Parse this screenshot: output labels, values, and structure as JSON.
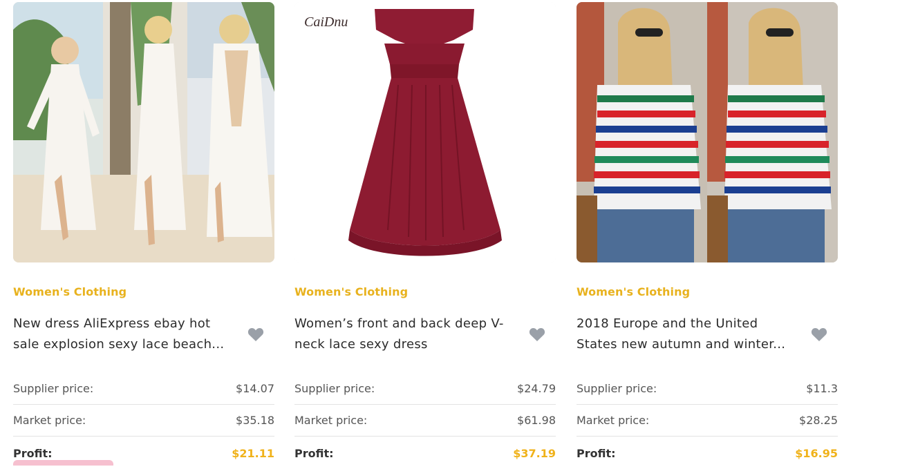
{
  "products": [
    {
      "image_desc": "white-lace-beach-dress-photo",
      "category": "Women's Clothing",
      "title": "New dress AliExpress ebay hot sale explosion sexy lace beach...",
      "supplier_label": "Supplier price:",
      "supplier_price": "$14.07",
      "market_label": "Market price:",
      "market_price": "$35.18",
      "profit_label": "Profit:",
      "profit": "$21.11"
    },
    {
      "image_desc": "burgundy-lace-dress-photo",
      "brand_mark": "CaiDnu",
      "category": "Women's Clothing",
      "title": "Women’s front and back deep V-neck lace sexy dress",
      "supplier_label": "Supplier price:",
      "supplier_price": "$24.79",
      "market_label": "Market price:",
      "market_price": "$61.98",
      "profit_label": "Profit:",
      "profit": "$37.19"
    },
    {
      "image_desc": "striped-sweater-photo",
      "category": "Women's Clothing",
      "title": "2018 Europe and the United States new autumn and winter...",
      "supplier_label": "Supplier price:",
      "supplier_price": "$11.3",
      "market_label": "Market price:",
      "market_price": "$28.25",
      "profit_label": "Profit:",
      "profit": "$16.95"
    }
  ],
  "colors": {
    "category": "#e8b21e",
    "profit": "#f0b21a",
    "heart": "#9aa0a8"
  }
}
